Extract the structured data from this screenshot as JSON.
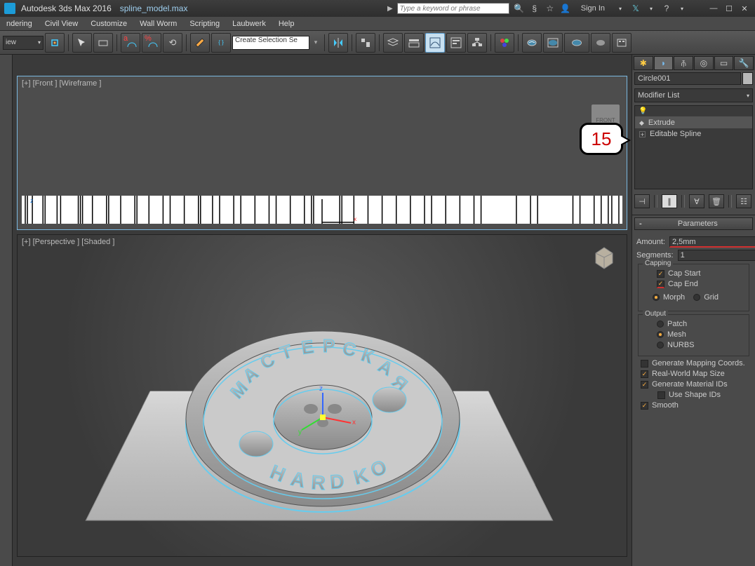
{
  "title": {
    "app": "Autodesk 3ds Max 2016",
    "file": "spline_model.max"
  },
  "search": {
    "placeholder": "Type a keyword or phrase",
    "sign_in": "Sign In"
  },
  "menus": [
    "ndering",
    "Civil View",
    "Customize",
    "Wall Worm",
    "Scripting",
    "Laubwerk",
    "Help"
  ],
  "toolbar": {
    "view_dropdown": "iew",
    "selection_set": "Create Selection Se"
  },
  "viewport_top": {
    "label": "[+] [Front ] [Wireframe ]",
    "orient_label": "FRONT"
  },
  "viewport_bottom": {
    "label": "[+] [Perspective ] [Shaded ]"
  },
  "callout": "15",
  "panel": {
    "object_name": "Circle001",
    "modifier_list_label": "Modifier List",
    "stack": {
      "m0": "Extrude",
      "m1": "Editable Spline"
    },
    "rollout_title": "Parameters",
    "amount": {
      "label": "Amount:",
      "value": "2,5mm"
    },
    "segments": {
      "label": "Segments:",
      "value": "1"
    },
    "capping": {
      "legend": "Capping",
      "cap_start": "Cap Start",
      "cap_end": "Cap End",
      "morph": "Morph",
      "grid": "Grid"
    },
    "output": {
      "legend": "Output",
      "patch": "Patch",
      "mesh": "Mesh",
      "nurbs": "NURBS"
    },
    "gen_mapping": "Generate Mapping Coords.",
    "real_world": "Real-World Map Size",
    "gen_material": "Generate Material IDs",
    "use_shape": "Use Shape IDs",
    "smooth": "Smooth"
  }
}
